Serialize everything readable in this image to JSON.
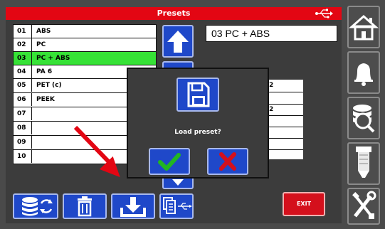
{
  "titlebar": {
    "title": "Presets",
    "icon": "usb-icon"
  },
  "presets": [
    {
      "num": "01",
      "name": "ABS"
    },
    {
      "num": "02",
      "name": "PC"
    },
    {
      "num": "03",
      "name": "PC + ABS"
    },
    {
      "num": "04",
      "name": "PA 6"
    },
    {
      "num": "05",
      "name": "PET (c)"
    },
    {
      "num": "06",
      "name": "PEEK"
    },
    {
      "num": "07",
      "name": ""
    },
    {
      "num": "08",
      "name": ""
    },
    {
      "num": "09",
      "name": ""
    },
    {
      "num": "10",
      "name": ""
    }
  ],
  "selected_index": 2,
  "selected_display": "03 PC + ABS",
  "background_table_digits": [
    "2",
    "2"
  ],
  "dialog": {
    "message": "Load preset?",
    "icon": "floppy-disk-icon",
    "confirm_icon": "checkmark-icon",
    "cancel_icon": "x-icon"
  },
  "toolbar": {
    "icons": [
      "database-sync-icon",
      "trash-icon",
      "download-icon",
      "copy-usb-icon"
    ],
    "exit_label": "EXIT"
  },
  "scroll": {
    "up_icon": "arrow-up-icon",
    "down_icon": "arrow-down-icon"
  },
  "sidebar": {
    "icons": [
      "home-icon",
      "bell-icon",
      "database-search-icon",
      "nozzle-icon",
      "tools-icon"
    ]
  },
  "colors": {
    "title_red": "#e30613",
    "selected_green": "#36e236",
    "button_blue": "#1f48c9",
    "confirm_green": "#22b522",
    "cancel_red": "#d4101c"
  }
}
